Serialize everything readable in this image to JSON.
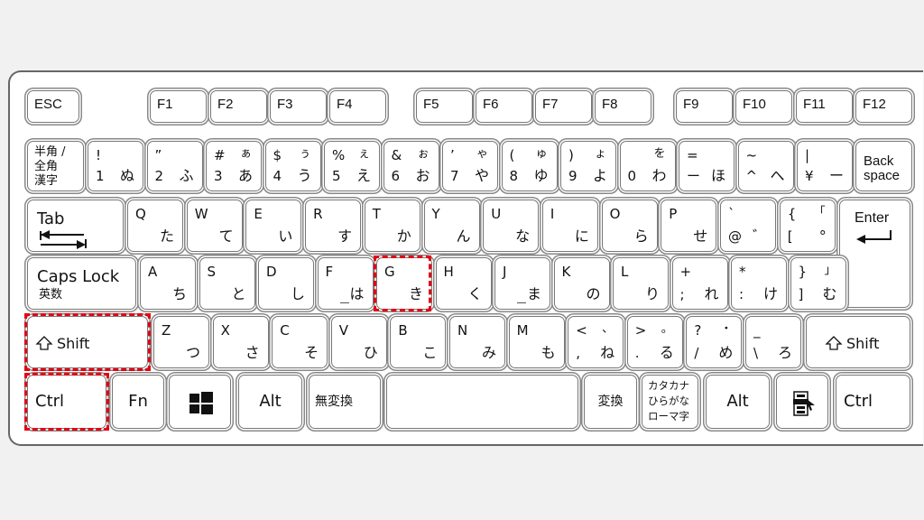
{
  "keyboard": {
    "layout": "Japanese JIS",
    "highlight_color": "#e60012",
    "highlighted_keys": [
      "Shift",
      "Ctrl",
      "G"
    ],
    "function_row": [
      {
        "id": "esc",
        "label": "ESC"
      },
      {
        "id": "f1",
        "label": "F1"
      },
      {
        "id": "f2",
        "label": "F2"
      },
      {
        "id": "f3",
        "label": "F3"
      },
      {
        "id": "f4",
        "label": "F4"
      },
      {
        "id": "f5",
        "label": "F5"
      },
      {
        "id": "f6",
        "label": "F6"
      },
      {
        "id": "f7",
        "label": "F7"
      },
      {
        "id": "f8",
        "label": "F8"
      },
      {
        "id": "f9",
        "label": "F9"
      },
      {
        "id": "f10",
        "label": "F10"
      },
      {
        "id": "f11",
        "label": "F11"
      },
      {
        "id": "f12",
        "label": "F12"
      }
    ],
    "number_row": [
      {
        "id": "hankaku",
        "lines": [
          "半角 /",
          "全角",
          "漢字"
        ]
      },
      {
        "id": "1",
        "shift": "!",
        "main": "1",
        "kana": "ぬ",
        "kana_shift": ""
      },
      {
        "id": "2",
        "shift": "”",
        "main": "2",
        "kana": "ふ",
        "kana_shift": ""
      },
      {
        "id": "3",
        "shift": "#",
        "main": "3",
        "kana": "あ",
        "kana_shift": "ぁ"
      },
      {
        "id": "4",
        "shift": "$",
        "main": "4",
        "kana": "う",
        "kana_shift": "ぅ"
      },
      {
        "id": "5",
        "shift": "%",
        "main": "5",
        "kana": "え",
        "kana_shift": "ぇ"
      },
      {
        "id": "6",
        "shift": "&",
        "main": "6",
        "kana": "お",
        "kana_shift": "ぉ"
      },
      {
        "id": "7",
        "shift": "’",
        "main": "7",
        "kana": "や",
        "kana_shift": "ゃ"
      },
      {
        "id": "8",
        "shift": "(",
        "main": "8",
        "kana": "ゆ",
        "kana_shift": "ゅ"
      },
      {
        "id": "9",
        "shift": ")",
        "main": "9",
        "kana": "よ",
        "kana_shift": "ょ"
      },
      {
        "id": "0",
        "shift": "",
        "main": "0",
        "kana": "わ",
        "kana_shift": "を"
      },
      {
        "id": "minus",
        "shift": "=",
        "main": "ー",
        "kana": "ほ",
        "kana_shift": ""
      },
      {
        "id": "caret",
        "shift": "~",
        "main": "^",
        "kana": "へ",
        "kana_shift": ""
      },
      {
        "id": "yen",
        "shift": "|",
        "main": "¥",
        "kana": "ー",
        "kana_shift": ""
      },
      {
        "id": "backspace",
        "lines": [
          "Back",
          "space"
        ]
      }
    ],
    "top_row": [
      {
        "id": "tab",
        "label": "Tab"
      },
      {
        "id": "q",
        "main": "Q",
        "kana": "た"
      },
      {
        "id": "w",
        "main": "W",
        "kana": "て"
      },
      {
        "id": "e",
        "main": "E",
        "kana": "い"
      },
      {
        "id": "r",
        "main": "R",
        "kana": "す"
      },
      {
        "id": "t",
        "main": "T",
        "kana": "か"
      },
      {
        "id": "y",
        "main": "Y",
        "kana": "ん"
      },
      {
        "id": "u",
        "main": "U",
        "kana": "な"
      },
      {
        "id": "i",
        "main": "I",
        "kana": "に"
      },
      {
        "id": "o",
        "main": "O",
        "kana": "ら"
      },
      {
        "id": "p",
        "main": "P",
        "kana": "せ"
      },
      {
        "id": "at",
        "shift": "`",
        "main": "@",
        "kana": "゛",
        "kana_shift": ""
      },
      {
        "id": "bracket-open",
        "shift": "{",
        "main": "[",
        "kana": "°",
        "kana_shift": "「"
      },
      {
        "id": "enter",
        "label": "Enter"
      }
    ],
    "home_row": [
      {
        "id": "caps",
        "label": "Caps Lock",
        "sub": "英数"
      },
      {
        "id": "a",
        "main": "A",
        "kana": "ち"
      },
      {
        "id": "s",
        "main": "S",
        "kana": "と"
      },
      {
        "id": "d",
        "main": "D",
        "kana": "し"
      },
      {
        "id": "f",
        "main": "F",
        "kana": "は"
      },
      {
        "id": "g",
        "main": "G",
        "kana": "き"
      },
      {
        "id": "h",
        "main": "H",
        "kana": "く"
      },
      {
        "id": "j",
        "main": "J",
        "kana": "ま"
      },
      {
        "id": "k",
        "main": "K",
        "kana": "の"
      },
      {
        "id": "l",
        "main": "L",
        "kana": "り"
      },
      {
        "id": "semicolon",
        "shift": "+",
        "main": ";",
        "kana": "れ",
        "kana_shift": ""
      },
      {
        "id": "colon",
        "shift": "*",
        "main": ":",
        "kana": "け",
        "kana_shift": ""
      },
      {
        "id": "bracket-close",
        "shift": "}",
        "main": "]",
        "kana": "む",
        "kana_shift": "」"
      }
    ],
    "shift_row": [
      {
        "id": "lshift",
        "label": "Shift"
      },
      {
        "id": "z",
        "main": "Z",
        "kana": "つ"
      },
      {
        "id": "x",
        "main": "X",
        "kana": "さ"
      },
      {
        "id": "c",
        "main": "C",
        "kana": "そ"
      },
      {
        "id": "v",
        "main": "V",
        "kana": "ひ"
      },
      {
        "id": "b",
        "main": "B",
        "kana": "こ"
      },
      {
        "id": "n",
        "main": "N",
        "kana": "み"
      },
      {
        "id": "m",
        "main": "M",
        "kana": "も"
      },
      {
        "id": "comma",
        "shift": "<",
        "main": ",",
        "kana": "ね",
        "kana_shift": "、"
      },
      {
        "id": "period",
        "shift": ">",
        "main": ".",
        "kana": "る",
        "kana_shift": "。"
      },
      {
        "id": "slash",
        "shift": "?",
        "main": "/",
        "kana": "め",
        "kana_shift": "・"
      },
      {
        "id": "backslash",
        "shift": "_",
        "main": "\\",
        "kana": "ろ",
        "kana_shift": ""
      },
      {
        "id": "rshift",
        "label": "Shift"
      }
    ],
    "bottom_row": [
      {
        "id": "lctrl",
        "label": "Ctrl"
      },
      {
        "id": "fn",
        "label": "Fn"
      },
      {
        "id": "win",
        "icon": "windows-logo-icon"
      },
      {
        "id": "lalt",
        "label": "Alt"
      },
      {
        "id": "muhenkan",
        "label": "無変換"
      },
      {
        "id": "space",
        "label": ""
      },
      {
        "id": "henkan",
        "label": "変換"
      },
      {
        "id": "kana",
        "lines": [
          "カタカナ",
          "ひらがな",
          "ローマ字"
        ]
      },
      {
        "id": "ralt",
        "label": "Alt"
      },
      {
        "id": "app",
        "icon": "application-menu-icon"
      },
      {
        "id": "rctrl",
        "label": "Ctrl"
      }
    ]
  }
}
